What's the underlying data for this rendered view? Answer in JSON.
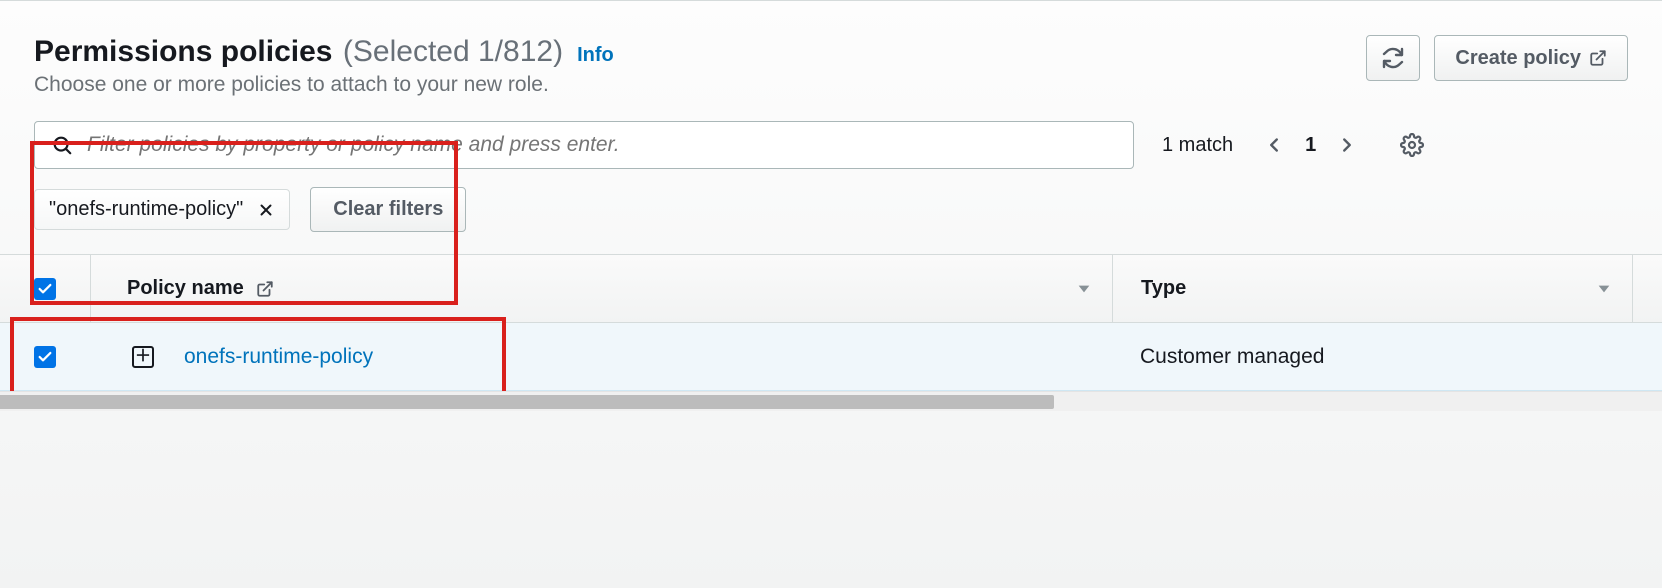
{
  "header": {
    "title": "Permissions policies",
    "selection_count": "(Selected 1/812)",
    "info_label": "Info",
    "subtitle": "Choose one or more policies to attach to your new role.",
    "create_policy_label": "Create policy"
  },
  "search": {
    "placeholder": "Filter policies by property or policy name and press enter.",
    "match_text": "1 match",
    "page_number": "1"
  },
  "filters": {
    "chip_text": "\"onefs-runtime-policy\"",
    "clear_label": "Clear filters"
  },
  "table": {
    "columns": {
      "policy_name": "Policy name",
      "type": "Type"
    },
    "rows": [
      {
        "checked": true,
        "name": "onefs-runtime-policy",
        "type": "Customer managed"
      }
    ]
  }
}
